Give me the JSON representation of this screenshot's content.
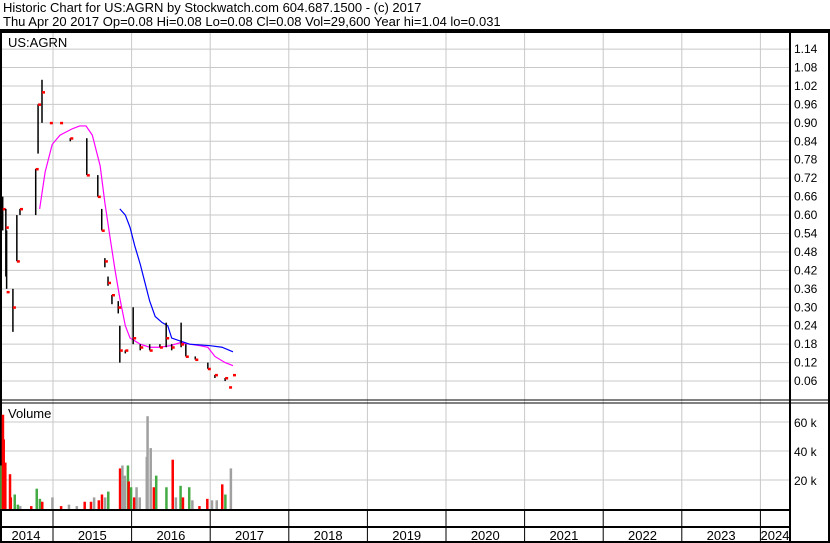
{
  "header": {
    "title": "Historic Chart for US:AGRN by Stockwatch.com 604.687.1500 - (c) 2017",
    "quote": "Thu Apr 20 2017  Op=0.08  Hi=0.08  Lo=0.08  Cl=0.08  Vol=29,600  Year hi=1.04  lo=0.031"
  },
  "colors": {
    "bar": "#000000",
    "close": "#ff0000",
    "ma_short": "#ff00ff",
    "ma_long": "#0000ff",
    "vol_up": "#44aa44",
    "vol_down": "#ff0000",
    "vol_flat": "#a0a0a0",
    "grid": "#c8c8c8"
  },
  "chart_data": [
    {
      "type": "ohlc",
      "title": "US:AGRN",
      "x_unit": "decimal year",
      "ylim": [
        0,
        1.17
      ],
      "y_ticks": [
        "1.14",
        "1.08",
        "1.02",
        "0.96",
        "0.90",
        "0.84",
        "0.78",
        "0.72",
        "0.66",
        "0.60",
        "0.54",
        "0.48",
        "0.42",
        "0.36",
        "0.30",
        "0.24",
        "0.18",
        "0.12",
        "0.06"
      ],
      "bars": [
        [
          2014.36,
          0.66,
          0.55,
          0.62
        ],
        [
          2014.4,
          0.62,
          0.4,
          0.56
        ],
        [
          2014.41,
          0.55,
          0.36,
          0.35
        ],
        [
          2014.49,
          0.36,
          0.22,
          0.3
        ],
        [
          2014.54,
          0.6,
          0.45,
          0.45
        ],
        [
          2014.58,
          0.62,
          0.6,
          0.62
        ],
        [
          2014.78,
          0.75,
          0.6,
          0.75
        ],
        [
          2014.81,
          0.96,
          0.8,
          0.96
        ],
        [
          2014.86,
          1.04,
          0.9,
          1.0
        ],
        [
          2014.96,
          0.9,
          0.9,
          0.9
        ],
        [
          2015.09,
          0.9,
          0.9,
          0.9
        ],
        [
          2015.22,
          0.85,
          0.84,
          0.85
        ],
        [
          2015.43,
          0.85,
          0.73,
          0.73
        ],
        [
          2015.57,
          0.73,
          0.66,
          0.66
        ],
        [
          2015.62,
          0.62,
          0.55,
          0.55
        ],
        [
          2015.66,
          0.46,
          0.43,
          0.45
        ],
        [
          2015.7,
          0.4,
          0.37,
          0.38
        ],
        [
          2015.75,
          0.34,
          0.31,
          0.34
        ],
        [
          2015.83,
          0.32,
          0.28,
          0.3
        ],
        [
          2015.85,
          0.24,
          0.12,
          0.16
        ],
        [
          2015.92,
          0.16,
          0.15,
          0.16
        ],
        [
          2016.02,
          0.3,
          0.18,
          0.2
        ],
        [
          2016.11,
          0.18,
          0.16,
          0.17
        ],
        [
          2016.23,
          0.18,
          0.16,
          0.16
        ],
        [
          2016.36,
          0.18,
          0.17,
          0.17
        ],
        [
          2016.44,
          0.25,
          0.17,
          0.2
        ],
        [
          2016.51,
          0.18,
          0.16,
          0.17
        ],
        [
          2016.63,
          0.25,
          0.17,
          0.18
        ],
        [
          2016.69,
          0.18,
          0.14,
          0.14
        ],
        [
          2016.81,
          0.14,
          0.13,
          0.13
        ],
        [
          2016.97,
          0.12,
          0.1,
          0.1
        ],
        [
          2017.06,
          0.08,
          0.07,
          0.08
        ],
        [
          2017.19,
          0.07,
          0.06,
          0.07
        ],
        [
          2017.24,
          0.04,
          0.04,
          0.04
        ],
        [
          2017.29,
          0.08,
          0.08,
          0.08
        ]
      ],
      "bar_fields": [
        "date",
        "high",
        "low",
        "close"
      ],
      "ma_short": [
        [
          2014.83,
          0.62
        ],
        [
          2014.9,
          0.74
        ],
        [
          2014.99,
          0.83
        ],
        [
          2015.09,
          0.86
        ],
        [
          2015.24,
          0.88
        ],
        [
          2015.34,
          0.89
        ],
        [
          2015.42,
          0.89
        ],
        [
          2015.5,
          0.86
        ],
        [
          2015.6,
          0.76
        ],
        [
          2015.66,
          0.64
        ],
        [
          2015.73,
          0.52
        ],
        [
          2015.79,
          0.42
        ],
        [
          2015.85,
          0.33
        ],
        [
          2015.92,
          0.24
        ],
        [
          2015.98,
          0.2
        ],
        [
          2016.11,
          0.18
        ],
        [
          2016.23,
          0.17
        ],
        [
          2016.36,
          0.17
        ],
        [
          2016.49,
          0.175
        ],
        [
          2016.62,
          0.185
        ],
        [
          2016.74,
          0.18
        ],
        [
          2016.87,
          0.175
        ],
        [
          2016.97,
          0.17
        ],
        [
          2017.06,
          0.14
        ],
        [
          2017.19,
          0.12
        ],
        [
          2017.29,
          0.11
        ]
      ],
      "ma_long": [
        [
          2015.85,
          0.62
        ],
        [
          2015.92,
          0.6
        ],
        [
          2015.98,
          0.56
        ],
        [
          2016.04,
          0.5
        ],
        [
          2016.11,
          0.44
        ],
        [
          2016.17,
          0.38
        ],
        [
          2016.23,
          0.32
        ],
        [
          2016.3,
          0.27
        ],
        [
          2016.39,
          0.25
        ],
        [
          2016.46,
          0.24
        ],
        [
          2016.51,
          0.2
        ],
        [
          2016.62,
          0.19
        ],
        [
          2016.74,
          0.18
        ],
        [
          2017.0,
          0.175
        ],
        [
          2017.15,
          0.17
        ],
        [
          2017.29,
          0.155
        ]
      ]
    },
    {
      "type": "bar",
      "title": "Volume",
      "ylim": [
        0,
        70000
      ],
      "y_ticks": [
        "60 k",
        "40 k",
        "20 k"
      ],
      "bars": [
        [
          2014.34,
          30000,
          "up"
        ],
        [
          2014.36,
          65000,
          "down"
        ],
        [
          2014.37,
          48000,
          "down"
        ],
        [
          2014.39,
          32000,
          "down"
        ],
        [
          2014.45,
          24000,
          "down"
        ],
        [
          2014.46,
          8000,
          "down"
        ],
        [
          2014.51,
          10000,
          "up"
        ],
        [
          2014.55,
          3000,
          "up"
        ],
        [
          2014.58,
          2000,
          "flat"
        ],
        [
          2014.79,
          14000,
          "up"
        ],
        [
          2014.83,
          7000,
          "up"
        ],
        [
          2014.86,
          5000,
          "down"
        ],
        [
          2014.72,
          2000,
          "down"
        ],
        [
          2014.99,
          8000,
          "flat"
        ],
        [
          2015.1,
          2000,
          "down"
        ],
        [
          2015.2,
          3000,
          "flat"
        ],
        [
          2015.3,
          2000,
          "flat"
        ],
        [
          2015.4,
          5000,
          "down"
        ],
        [
          2015.48,
          5000,
          "down"
        ],
        [
          2015.52,
          8000,
          "flat"
        ],
        [
          2015.58,
          6000,
          "down"
        ],
        [
          2015.62,
          10000,
          "down"
        ],
        [
          2015.66,
          8000,
          "flat"
        ],
        [
          2015.7,
          12000,
          "up"
        ],
        [
          2015.85,
          28000,
          "down"
        ],
        [
          2015.88,
          30000,
          "flat"
        ],
        [
          2015.91,
          23000,
          "flat"
        ],
        [
          2015.95,
          30000,
          "up"
        ],
        [
          2015.96,
          19000,
          "down"
        ],
        [
          2015.99,
          15000,
          "up"
        ],
        [
          2016.03,
          8000,
          "down"
        ],
        [
          2016.06,
          15000,
          "flat"
        ],
        [
          2016.1,
          8000,
          "flat"
        ],
        [
          2016.19,
          36000,
          "flat"
        ],
        [
          2016.2,
          64000,
          "flat"
        ],
        [
          2016.24,
          42000,
          "flat"
        ],
        [
          2016.28,
          15000,
          "down"
        ],
        [
          2016.31,
          23000,
          "up"
        ],
        [
          2016.44,
          15000,
          "up"
        ],
        [
          2016.52,
          34000,
          "down"
        ],
        [
          2016.56,
          8000,
          "flat"
        ],
        [
          2016.62,
          16000,
          "up"
        ],
        [
          2016.65,
          8000,
          "down"
        ],
        [
          2016.73,
          15000,
          "up"
        ],
        [
          2016.77,
          6000,
          "flat"
        ],
        [
          2016.86,
          2000,
          "down"
        ],
        [
          2016.96,
          7000,
          "down"
        ],
        [
          2017.02,
          6000,
          "flat"
        ],
        [
          2017.08,
          6000,
          "flat"
        ],
        [
          2017.15,
          17000,
          "down"
        ],
        [
          2017.19,
          10000,
          "up"
        ],
        [
          2017.26,
          28000,
          "flat"
        ]
      ]
    }
  ],
  "x_axis": {
    "labels": [
      "2014",
      "2015",
      "2016",
      "2017",
      "2018",
      "2019",
      "2020",
      "2021",
      "2022",
      "2023",
      "2024"
    ]
  }
}
